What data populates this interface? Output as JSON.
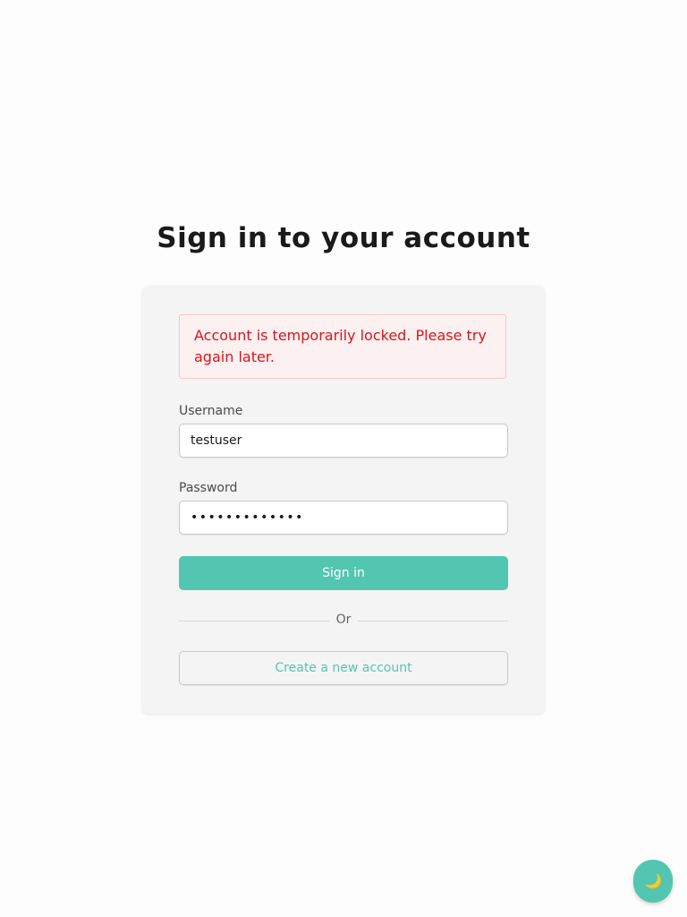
{
  "page": {
    "title": "Sign in to your account"
  },
  "alert": {
    "message": "Account is temporarily locked. Please try again later."
  },
  "form": {
    "username_label": "Username",
    "username_value": "testuser",
    "password_label": "Password",
    "password_value": "•••••••••••••",
    "submit_label": "Sign in",
    "divider_text": "Or",
    "create_account_label": "Create a new account"
  },
  "theme_toggle": {
    "icon": "moon-icon",
    "glyph": "🌙"
  },
  "colors": {
    "accent": "#52c6b0",
    "error_text": "#d6161e",
    "error_bg": "#fdf0f0",
    "card_bg": "#f4f4f4"
  }
}
